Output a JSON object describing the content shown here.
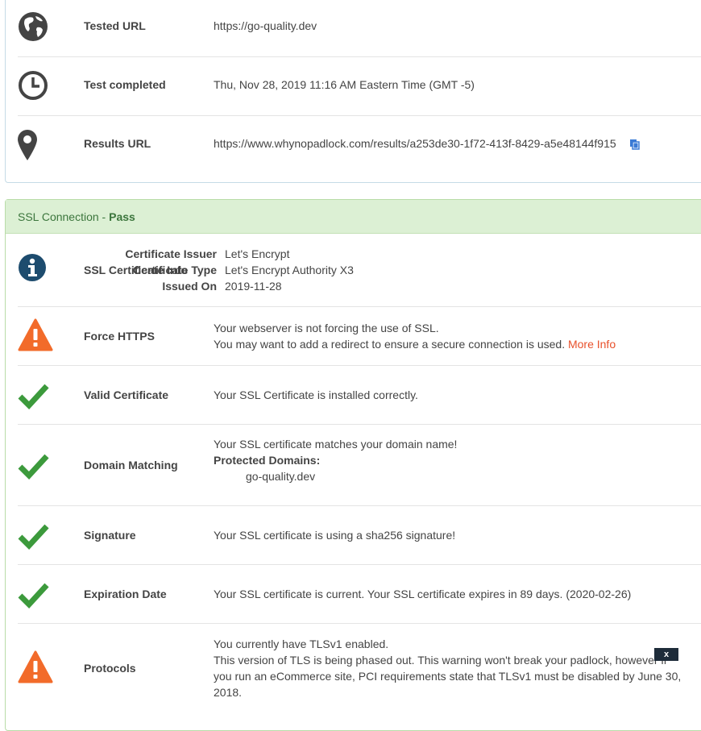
{
  "overview": {
    "rows": [
      {
        "label": "Tested URL",
        "value": "https://go-quality.dev",
        "icon": "globe-icon"
      },
      {
        "label": "Test completed",
        "value": "Thu, Nov 28, 2019 11:16 AM Eastern Time (GMT -5)",
        "icon": "clock-icon"
      },
      {
        "label": "Results URL",
        "value": "https://www.whynopadlock.com/results/a253de30-1f72-413f-8429-a5e48144f915",
        "icon": "map-pin-icon"
      }
    ]
  },
  "ssl": {
    "header_prefix": "SSL Connection - ",
    "header_status": "Pass",
    "cert_info": {
      "label": "SSL Certificate Info",
      "issuer_key": "Certificate Issuer",
      "issuer_val": "Let's Encrypt",
      "type_key": "Certificate Type",
      "type_val": "Let's Encrypt Authority X3",
      "issued_key": "Issued On",
      "issued_val": "2019-11-28"
    },
    "force_https": {
      "label": "Force HTTPS",
      "line1": "Your webserver is not forcing the use of SSL.",
      "line2": "You may want to add a redirect to ensure a secure connection is used.",
      "link": "More Info"
    },
    "valid_cert": {
      "label": "Valid Certificate",
      "text": "Your SSL Certificate is installed correctly."
    },
    "domain_matching": {
      "label": "Domain Matching",
      "line1": "Your SSL certificate matches your domain name!",
      "protected_label": "Protected Domains:",
      "domain": "go-quality.dev"
    },
    "signature": {
      "label": "Signature",
      "text": "Your SSL certificate is using a sha256 signature!"
    },
    "expiration": {
      "label": "Expiration Date",
      "text": "Your SSL certificate is current. Your SSL certificate expires in 89 days. (2020-02-26)"
    },
    "protocols": {
      "label": "Protocols",
      "line1": "You currently have TLSv1 enabled.",
      "line2": "This version of TLS is being phased out. This warning won't break your padlock, however if",
      "line3": "you run an eCommerce site, PCI requirements state that TLSv1 must be disabled by June 30,",
      "line4": "2018."
    }
  },
  "close_label": "x",
  "colors": {
    "pass_green": "#3c9a3c",
    "warn_orange": "#f26b2a",
    "info_blue": "#1d4c6e",
    "icon_dark": "#444444",
    "link": "#e8502a"
  }
}
